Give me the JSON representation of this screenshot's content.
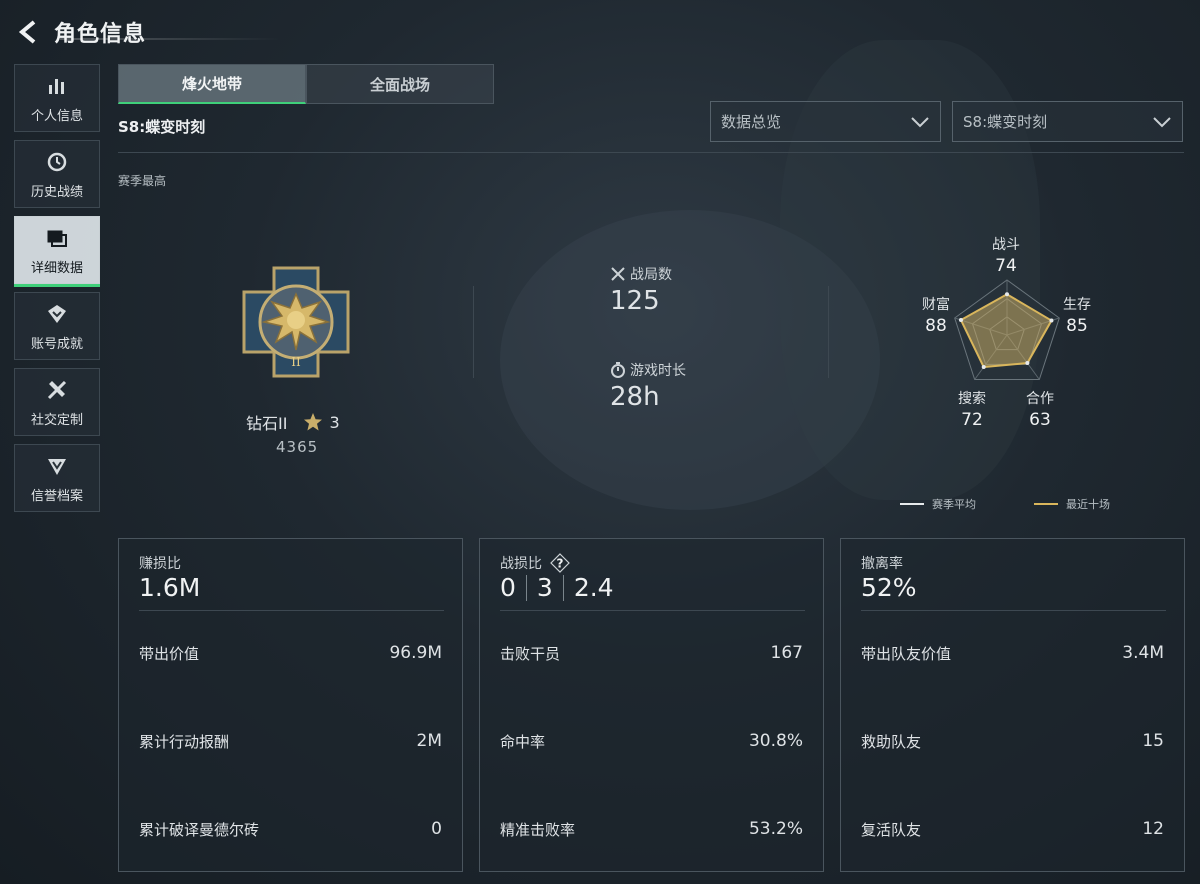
{
  "header": {
    "title": "角色信息"
  },
  "sidebar": {
    "items": [
      {
        "label": "个人信息",
        "icon": "bar-chart-icon",
        "active": false
      },
      {
        "label": "历史战绩",
        "icon": "clock-history-icon",
        "active": false
      },
      {
        "label": "详细数据",
        "icon": "folder-icon",
        "active": true
      },
      {
        "label": "账号成就",
        "icon": "achievement-badge-icon",
        "active": false
      },
      {
        "label": "社交定制",
        "icon": "wrench-tools-icon",
        "active": false
      },
      {
        "label": "信誉档案",
        "icon": "shield-emblem-icon",
        "active": false
      }
    ]
  },
  "tabs": [
    {
      "label": "烽火地带",
      "active": true
    },
    {
      "label": "全面战场",
      "active": false
    }
  ],
  "season_title": "S8:蝶变时刻",
  "filters": {
    "view": "数据总览",
    "season": "S8:蝶变时刻"
  },
  "best": {
    "label": "赛季最高",
    "rank_name": "钻石II",
    "rank_stars": "3",
    "rank_score": "4365"
  },
  "summary": {
    "matches_label": "战局数",
    "matches_value": "125",
    "playtime_label": "游戏时长",
    "playtime_value": "28h"
  },
  "radar": {
    "axes": [
      {
        "label": "战斗",
        "value": "74"
      },
      {
        "label": "生存",
        "value": "85"
      },
      {
        "label": "合作",
        "value": "63"
      },
      {
        "label": "搜索",
        "value": "72"
      },
      {
        "label": "财富",
        "value": "88"
      }
    ],
    "values": [
      74,
      85,
      63,
      72,
      88
    ],
    "legend_avg": "赛季平均",
    "legend_recent": "最近十场",
    "colors": {
      "avg": "#e6e9eb",
      "recent": "#d9b65c"
    }
  },
  "cards": {
    "profit": {
      "title": "赚损比",
      "main": "1.6M",
      "rows": [
        {
          "label": "带出价值",
          "value": "96.9M"
        },
        {
          "label": "累计行动报酬",
          "value": "2M"
        },
        {
          "label": "累计破译曼德尔砖",
          "value": "0"
        }
      ]
    },
    "combat": {
      "title": "战损比",
      "main_a": "0",
      "main_b": "3",
      "main_c": "2.4",
      "rows": [
        {
          "label": "击败干员",
          "value": "167"
        },
        {
          "label": "命中率",
          "value": "30.8%"
        },
        {
          "label": "精准击败率",
          "value": "53.2%"
        }
      ]
    },
    "extract": {
      "title": "撤离率",
      "main": "52%",
      "rows": [
        {
          "label": "带出队友价值",
          "value": "3.4M"
        },
        {
          "label": "救助队友",
          "value": "15"
        },
        {
          "label": "复活队友",
          "value": "12"
        }
      ]
    }
  }
}
